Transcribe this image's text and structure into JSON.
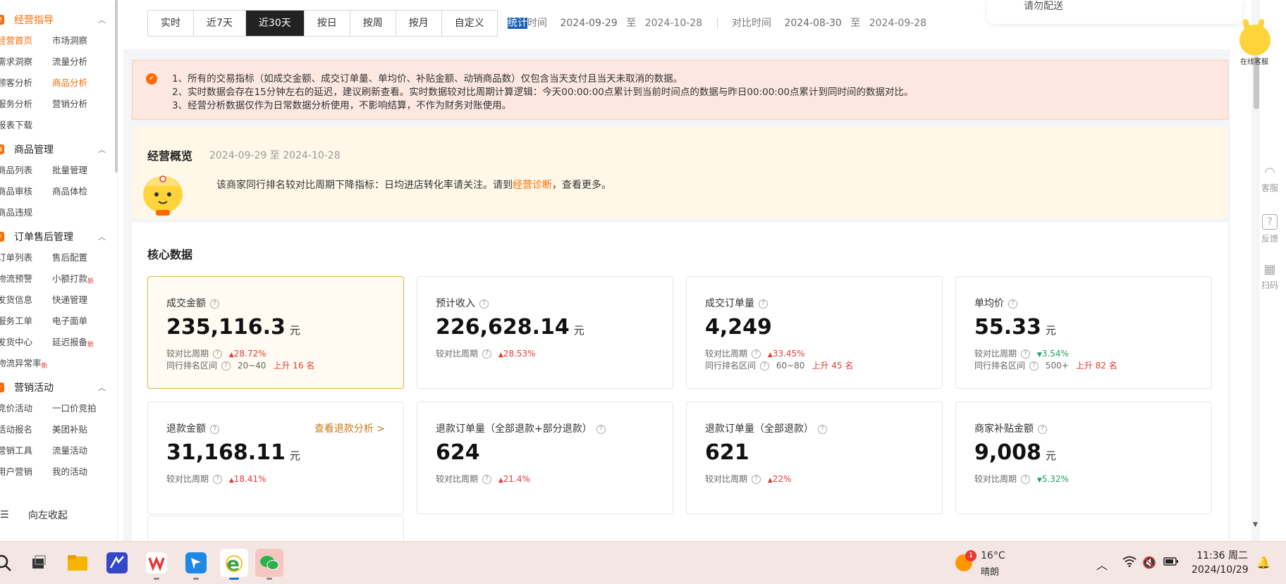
{
  "sidebar": {
    "sections": [
      {
        "label": "经营指导",
        "icon": "chart-pie-icon",
        "active": true,
        "items": [
          {
            "label": "经营首页",
            "active": true
          },
          {
            "label": "市场洞察"
          },
          {
            "label": "需求洞察"
          },
          {
            "label": "流量分析"
          },
          {
            "label": "顾客分析"
          },
          {
            "label": "商品分析",
            "active": true
          },
          {
            "label": "服务分析"
          },
          {
            "label": "营销分析"
          },
          {
            "label": "报表下载"
          }
        ]
      },
      {
        "label": "商品管理",
        "icon": "bag-icon",
        "items": [
          {
            "label": "商品列表"
          },
          {
            "label": "批量管理"
          },
          {
            "label": "商品审核"
          },
          {
            "label": "商品体检"
          },
          {
            "label": "商品违规"
          }
        ]
      },
      {
        "label": "订单售后管理",
        "icon": "list-icon",
        "items": [
          {
            "label": "订单列表"
          },
          {
            "label": "售后配置"
          },
          {
            "label": "物流预警"
          },
          {
            "label": "小额打款",
            "new": "新"
          },
          {
            "label": "发货信息"
          },
          {
            "label": "快递管理"
          },
          {
            "label": "服务工单"
          },
          {
            "label": "电子面单"
          },
          {
            "label": "发货中心"
          },
          {
            "label": "延迟报备",
            "new": "新"
          },
          {
            "label": "物流异常率",
            "new": "新"
          }
        ]
      },
      {
        "label": "营销活动",
        "icon": "gift-icon",
        "items": [
          {
            "label": "竞价活动"
          },
          {
            "label": "一口价竞拍"
          },
          {
            "label": "活动报名"
          },
          {
            "label": "美团补贴"
          },
          {
            "label": "营销工具"
          },
          {
            "label": "流量活动"
          },
          {
            "label": "用户营销"
          },
          {
            "label": "我的活动"
          }
        ]
      }
    ],
    "collapse_label": "向左收起"
  },
  "filter": {
    "tabs": [
      "实时",
      "近7天",
      "近30天",
      "按日",
      "按周",
      "按月",
      "自定义"
    ],
    "active_tab": 2,
    "stat_label_hl": "统计",
    "stat_label_rest": "时间",
    "stat_start": "2024-09-29",
    "stat_to": "至",
    "stat_end": "2024-10-28",
    "cmp_label": "对比时间",
    "cmp_start": "2024-08-30",
    "cmp_to": "至",
    "cmp_end": "2024-09-28"
  },
  "notice": {
    "lines": [
      "1、所有的交易指标（如成交金额、成交订单量、单均价、补贴金额、动销商品数）仅包含当天支付且当天未取消的数据。",
      "2、实时数据会存在15分钟左右的延迟，建议刷新查看。实时数据较对比周期计算逻辑：今天00:00:00点累计到当前时间点的数据与昨日00:00:00点累计到同时间的数据对比。",
      "3、经营分析数据仅作为日常数据分析使用，不影响结算，不作为财务对账使用。"
    ]
  },
  "overview": {
    "title": "经营概览",
    "range": "2024-09-29 至 2024-10-28",
    "tip_before": "该商家同行排名较对比周期下降指标：日均进店转化率请关注。请到",
    "tip_link": "经营诊断",
    "tip_after": "，查看更多。"
  },
  "core": {
    "title": "核心数据",
    "cards": [
      {
        "label": "成交金额",
        "value": "235,116.3",
        "unit": "元",
        "cmp_label": "较对比周期",
        "cmp_dir": "up",
        "cmp_value": "28.72%",
        "rank_label": "同行排名区间",
        "rank_range": "20~40",
        "rank_change": "上升 16 名",
        "selected": true
      },
      {
        "label": "预计收入",
        "value": "226,628.14",
        "unit": "元",
        "cmp_label": "较对比周期",
        "cmp_dir": "up",
        "cmp_value": "28.53%"
      },
      {
        "label": "成交订单量",
        "value": "4,249",
        "unit": "",
        "cmp_label": "较对比周期",
        "cmp_dir": "up",
        "cmp_value": "33.45%",
        "rank_label": "同行排名区间",
        "rank_range": "60~80",
        "rank_change": "上升 45 名"
      },
      {
        "label": "单均价",
        "value": "55.33",
        "unit": "元",
        "cmp_label": "较对比周期",
        "cmp_dir": "down",
        "cmp_value": "3.54%",
        "rank_label": "同行排名区间",
        "rank_range": "500+",
        "rank_change": "上升 82 名"
      },
      {
        "label": "退款金额",
        "value": "31,168.11",
        "unit": "元",
        "cmp_label": "较对比周期",
        "cmp_dir": "up",
        "cmp_value": "18.41%",
        "link": "查看退款分析 >"
      },
      {
        "label": "退款订单量（全部退款+部分退款）",
        "value": "624",
        "unit": "",
        "cmp_label": "较对比周期",
        "cmp_dir": "up",
        "cmp_value": "21.4%"
      },
      {
        "label": "退款订单量（全部退款）",
        "value": "621",
        "unit": "",
        "cmp_label": "较对比周期",
        "cmp_dir": "up",
        "cmp_value": "22%"
      },
      {
        "label": "商家补贴金额",
        "value": "9,008",
        "unit": "元",
        "cmp_label": "较对比周期",
        "cmp_dir": "down",
        "cmp_value": "5.32%"
      }
    ]
  },
  "rail": {
    "top_tip": "请勿配送",
    "assistant_label": "在线客服",
    "items": [
      {
        "label": "客服",
        "icon": "headset-icon"
      },
      {
        "label": "反馈",
        "icon": "question-icon"
      },
      {
        "label": "扫码",
        "icon": "qr-code-icon"
      }
    ]
  },
  "taskbar": {
    "weather_badge": "1",
    "temperature": "16°C",
    "condition": "晴朗",
    "time": "11:36 周二",
    "date": "2024/10/29"
  },
  "colors": {
    "accent": "#ff6a00",
    "up": "#e53935",
    "down": "#1aa35c",
    "selected_border": "#e7b34a"
  }
}
